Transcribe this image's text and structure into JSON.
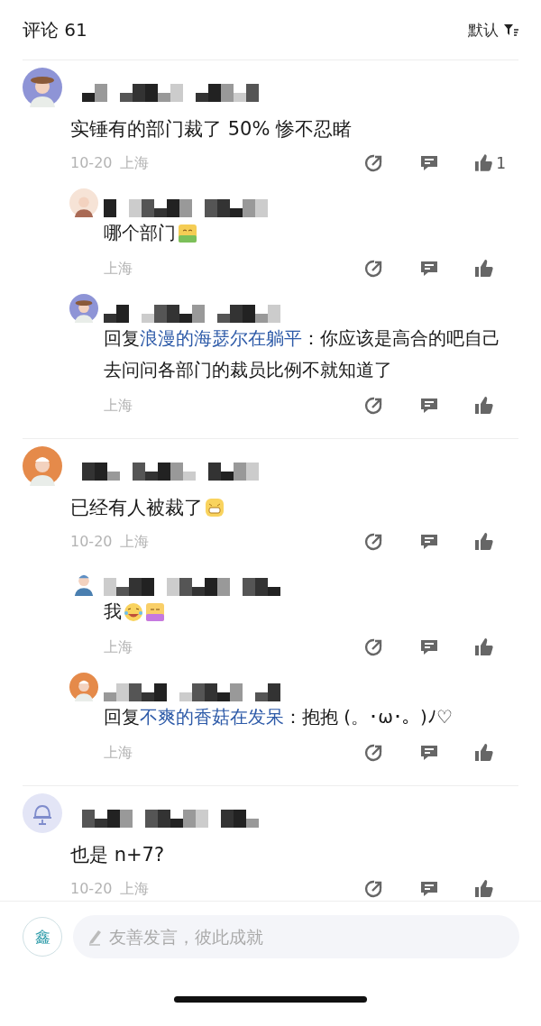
{
  "header": {
    "title": "评论 61",
    "sort": "默认"
  },
  "comments": [
    {
      "text": "实锤有的部门裁了 50%   惨不忍睹",
      "date": "10-20",
      "location": "上海",
      "likes": "1",
      "replies": [
        {
          "text": "哪个部门",
          "stickers": [
            {
              "kind": "mark"
            }
          ],
          "location": "上海"
        },
        {
          "prefix": "回复",
          "reply_to": "浪漫的海瑟尔在躺平",
          "text": "：你应该是高合的吧自己去问问各部门的裁员比例不就知道了",
          "location": "上海"
        }
      ]
    },
    {
      "text": "已经有人被裁了",
      "stickers": [
        {
          "kind": "grin"
        }
      ],
      "date": "10-20",
      "location": "上海",
      "replies": [
        {
          "text": "我",
          "stickers": [
            {
              "kind": "laugh"
            },
            {
              "kind": "badge"
            }
          ],
          "location": "上海"
        },
        {
          "prefix": "回复",
          "reply_to": "不爽的香菇在发呆",
          "text": "：抱抱 (。･ω･。)ﾉ♡",
          "location": "上海"
        }
      ]
    },
    {
      "text": "也是 n+7?",
      "date": "10-20",
      "location": "上海"
    }
  ],
  "composer": {
    "avatar_text": "鑫",
    "placeholder": "友善发言，彼此成就"
  }
}
